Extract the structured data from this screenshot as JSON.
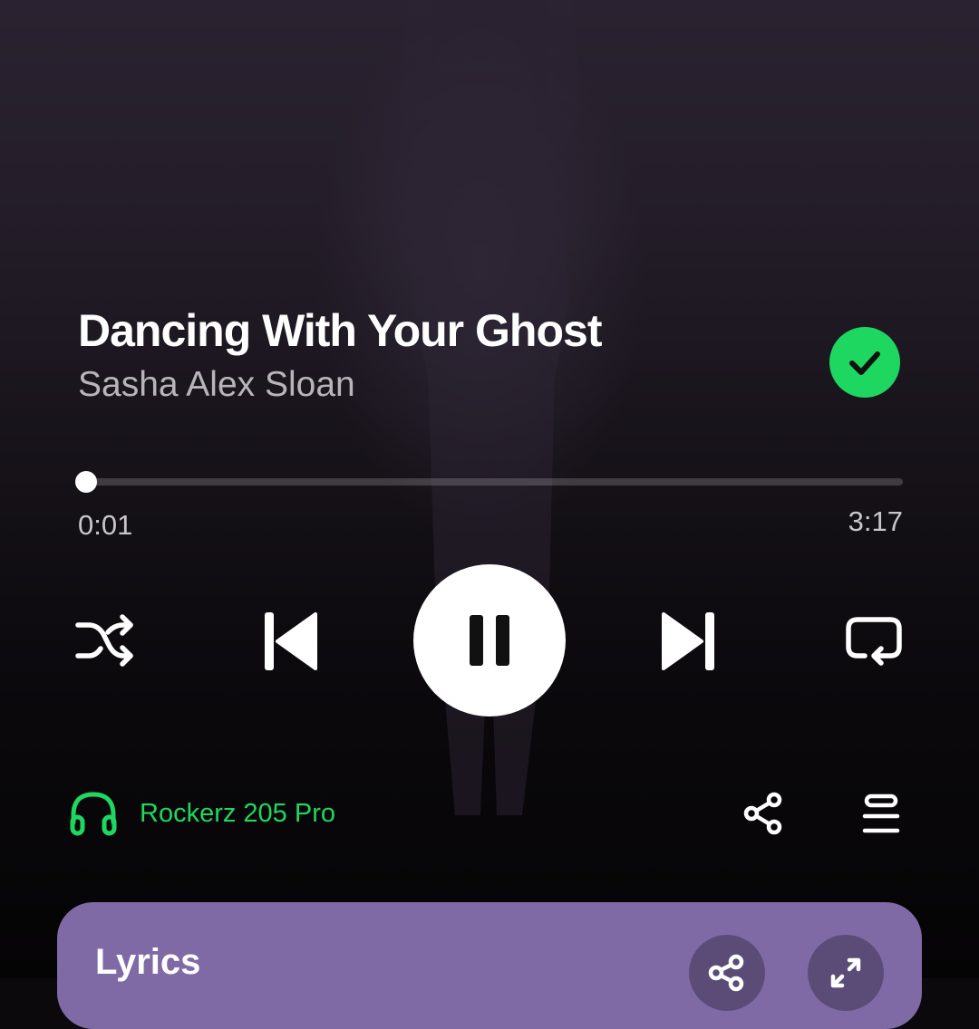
{
  "track": {
    "title": "Dancing With Your Ghost",
    "artist": "Sasha Alex Sloan",
    "liked_icon": "check-circle-icon",
    "liked_color": "#1ed760"
  },
  "playback": {
    "elapsed": "0:01",
    "duration": "3:17",
    "progress_fraction": 0.005
  },
  "controls": {
    "shuffle_icon": "shuffle-icon",
    "previous_icon": "skip-previous-icon",
    "pause_icon": "pause-icon",
    "next_icon": "skip-next-icon",
    "repeat_icon": "repeat-icon"
  },
  "device": {
    "icon": "headphones-icon",
    "name": "Rockerz 205 Pro",
    "color": "#1ed760"
  },
  "actions": {
    "share_icon": "share-icon",
    "queue_icon": "queue-icon"
  },
  "lyrics": {
    "title": "Lyrics",
    "share_icon": "share-icon",
    "expand_icon": "expand-icon",
    "card_color": "#7f6aa6"
  }
}
